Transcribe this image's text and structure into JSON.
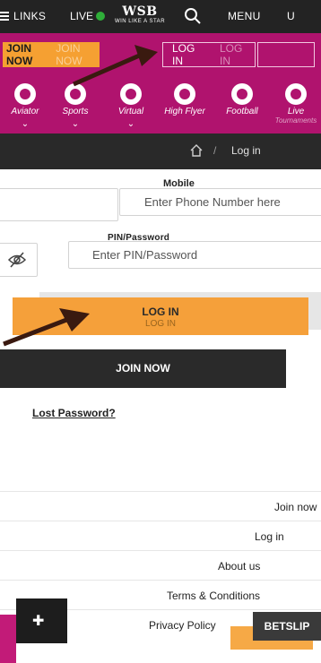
{
  "topnav": {
    "links_label": "LINKS",
    "live_label": "LIVE",
    "logo_brand": "WSB",
    "logo_tagline": "WIN LIKE A STAR",
    "menu_label": "MENU",
    "user_label": "U"
  },
  "magenta_bar": {
    "join_label": "JOIN NOW",
    "join_ghost": "JOIN NOW",
    "login_label": "LOG IN",
    "login_ghost": "LOG IN",
    "categories": [
      {
        "label": "Aviator"
      },
      {
        "label": "Sports"
      },
      {
        "label": "Virtual"
      },
      {
        "label": "High Flyer"
      },
      {
        "label": "Football"
      },
      {
        "label": "Live"
      }
    ],
    "category_labels_extra": "Tournaments"
  },
  "breadcrumb": {
    "separator": "/",
    "current": "Log in"
  },
  "form": {
    "mobile_label": "Mobile",
    "phone_placeholder": "Enter Phone Number here",
    "pin_label": "PIN/Password",
    "pin_placeholder": "Enter PIN/Password",
    "login_button": "LOG IN",
    "login_button_ghost": "LOG IN",
    "join_button": "JOIN NOW",
    "lost_password": "Lost Password?"
  },
  "footer": {
    "links": [
      {
        "label": "Join now"
      },
      {
        "label": "Log in"
      },
      {
        "label": "About us"
      },
      {
        "label": "Terms & Conditions"
      },
      {
        "label": "Privacy Policy"
      }
    ],
    "betslip_label": "BETSLIP"
  },
  "colors": {
    "magenta": "#b0136e",
    "orange": "#f5a032",
    "dark": "#232323",
    "live_dot": "#2fae39"
  }
}
